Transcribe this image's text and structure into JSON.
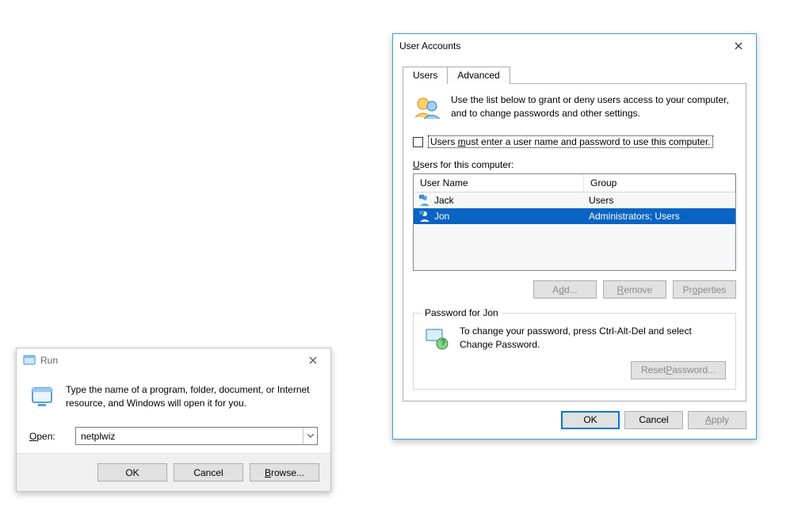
{
  "run": {
    "title": "Run",
    "desc": "Type the name of a program, folder, document, or Internet resource, and Windows will open it for you.",
    "open_label": "Open:",
    "value": "netplwiz",
    "ok": "OK",
    "cancel": "Cancel",
    "browse": "Browse..."
  },
  "ua": {
    "title": "User Accounts",
    "tabs": {
      "users": "Users",
      "advanced": "Advanced"
    },
    "info": "Use the list below to grant or deny users access to your computer, and to change passwords and other settings.",
    "checkbox_label": "Users must enter a user name and password to use this computer.",
    "users_for_label": "Users for this computer:",
    "col_username": "User Name",
    "col_group": "Group",
    "rows": [
      {
        "name": "Jack",
        "group": "Users",
        "selected": false
      },
      {
        "name": "Jon",
        "group": "Administrators; Users",
        "selected": true
      }
    ],
    "add": "Add...",
    "remove": "Remove",
    "properties": "Properties",
    "group_title": "Password for Jon",
    "group_text": "To change your password, press Ctrl-Alt-Del and select Change Password.",
    "reset_pw": "Reset Password...",
    "ok": "OK",
    "cancel": "Cancel",
    "apply": "Apply"
  }
}
